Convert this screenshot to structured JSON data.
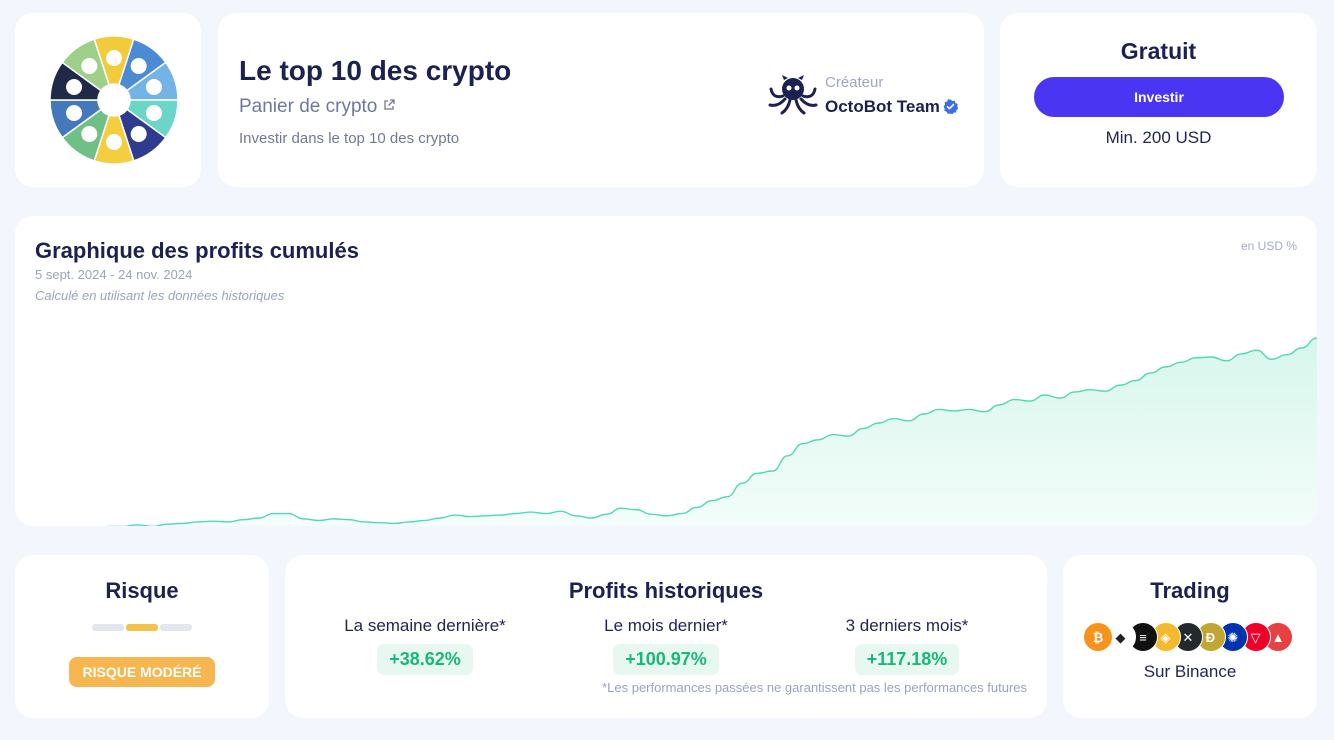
{
  "basket": {
    "title": "Le top 10 des crypto",
    "subtitle": "Panier de crypto",
    "description": "Investir dans le top 10 des crypto"
  },
  "creator": {
    "label": "Créateur",
    "name": "OctoBot Team"
  },
  "pricing": {
    "price": "Gratuit",
    "button_label": "Investir",
    "minimum": "Min. 200 USD"
  },
  "chart": {
    "title": "Graphique des profits cumulés",
    "date_range": "5 sept. 2024 - 24 nov. 2024",
    "note": "Calculé en utilisant les données historiques",
    "unit": "en USD %"
  },
  "chart_data": {
    "type": "area",
    "title": "Graphique des profits cumulés",
    "x_range": [
      "2024-09-05",
      "2024-11-24"
    ],
    "values": [
      -2,
      -2,
      0,
      -2,
      1,
      2,
      4,
      5,
      4,
      7,
      9,
      15,
      15,
      8,
      6,
      8,
      7,
      4,
      3,
      2,
      4,
      6,
      9,
      13,
      11,
      12,
      13,
      15,
      17,
      15,
      18,
      12,
      9,
      14,
      22,
      20,
      14,
      12,
      15,
      23,
      32,
      37,
      55,
      68,
      71,
      91,
      107,
      112,
      119,
      117,
      127,
      134,
      140,
      137,
      146,
      152,
      150,
      152,
      149,
      158,
      165,
      163,
      171,
      167,
      175,
      178,
      176,
      184,
      190,
      200,
      208,
      214,
      220,
      221,
      216,
      225,
      230,
      218,
      224,
      233,
      246
    ],
    "final_value": 117.18,
    "series_color": "#4fd8b4",
    "fill_color": "#e6f9f3",
    "grid": false
  },
  "risk": {
    "title": "Risque",
    "level": 2,
    "levels": 3,
    "badge": "RISQUE MODÉRÉ"
  },
  "profits": {
    "title": "Profits historiques",
    "periods": [
      {
        "label": "La semaine dernière*",
        "value": "+38.62%"
      },
      {
        "label": "Le mois dernier*",
        "value": "+100.97%"
      },
      {
        "label": "3 derniers mois*",
        "value": "+117.18%"
      }
    ],
    "disclaimer": "*Les performances passées ne garantissent pas les performances futures"
  },
  "trading": {
    "title": "Trading",
    "exchange": "Sur Binance",
    "coins": [
      {
        "name": "bitcoin",
        "glyph": "₿",
        "color": "#f7931a"
      },
      {
        "name": "ethereum",
        "glyph": "◆",
        "color": "#ffffff"
      },
      {
        "name": "solana",
        "glyph": "≡",
        "color": "#111111"
      },
      {
        "name": "bnb",
        "glyph": "◈",
        "color": "#f3ba2f"
      },
      {
        "name": "xrp",
        "glyph": "✕",
        "color": "#23292f"
      },
      {
        "name": "dogecoin",
        "glyph": "Ð",
        "color": "#c2a633"
      },
      {
        "name": "cardano",
        "glyph": "✺",
        "color": "#0033ad"
      },
      {
        "name": "tron",
        "glyph": "▽",
        "color": "#ef0027"
      },
      {
        "name": "avalanche",
        "glyph": "▲",
        "color": "#e84142"
      }
    ]
  },
  "wheel": {
    "segments": [
      {
        "color": "#f2cb3a",
        "icon": "solana-icon"
      },
      {
        "color": "#4a8bd4",
        "icon": "ethereum-icon"
      },
      {
        "color": "#74b3e6",
        "icon": "bitcoin-icon"
      },
      {
        "color": "#6bd6c8",
        "icon": "polygon-icon"
      },
      {
        "color": "#2e3c8f",
        "icon": "avalanche-icon"
      },
      {
        "color": "#f5ce3f",
        "icon": "tron-icon"
      },
      {
        "color": "#6fbf86",
        "icon": "cardano-icon"
      },
      {
        "color": "#4477bb",
        "icon": "dogecoin-icon"
      },
      {
        "color": "#1e2a48",
        "icon": "xrp-icon"
      },
      {
        "color": "#9fd08a",
        "icon": "bnb-icon"
      }
    ]
  }
}
